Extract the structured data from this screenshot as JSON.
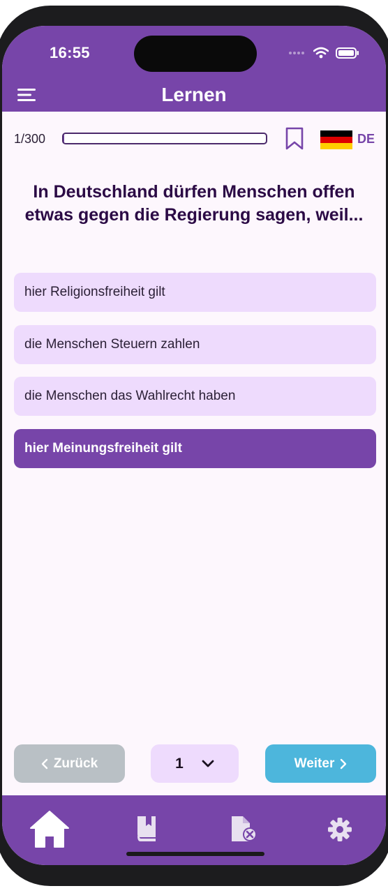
{
  "status": {
    "time": "16:55"
  },
  "header": {
    "title": "Lernen"
  },
  "progress": {
    "count_label": "1/300",
    "fraction": 0.0033
  },
  "language": {
    "code": "DE"
  },
  "question": {
    "text": "In Deutschland dürfen Menschen offen etwas gegen die Regierung sagen, weil..."
  },
  "answers": [
    {
      "label": "hier Religionsfreiheit gilt",
      "selected": false
    },
    {
      "label": "die Menschen Steuern zahlen",
      "selected": false
    },
    {
      "label": "die Menschen das Wahlrecht haben",
      "selected": false
    },
    {
      "label": "hier Meinungsfreiheit gilt",
      "selected": true
    }
  ],
  "navigation": {
    "back_label": "Zurück",
    "page_value": "1",
    "next_label": "Weiter"
  },
  "tabs": [
    {
      "icon": "home-icon"
    },
    {
      "icon": "book-bookmark-icon"
    },
    {
      "icon": "document-error-icon"
    },
    {
      "icon": "gear-icon"
    }
  ],
  "colors": {
    "primary": "#7745a9",
    "answer_bg": "#eedbfd",
    "back_button": "#b9c0c5",
    "next_button": "#4db6dc",
    "question_text": "#2b0a45"
  }
}
